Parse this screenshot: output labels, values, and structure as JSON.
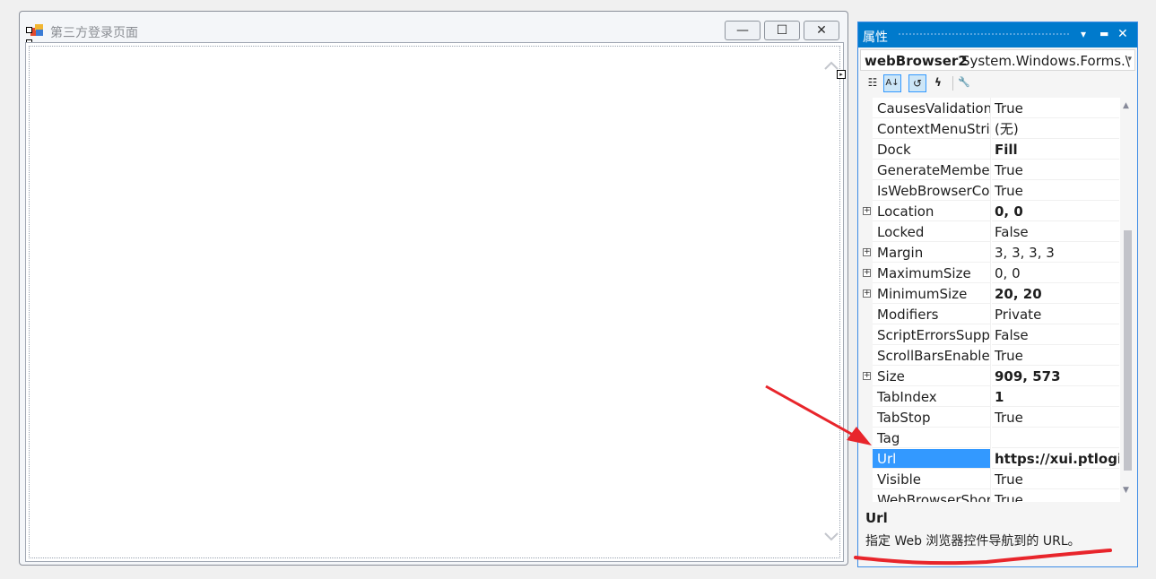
{
  "form": {
    "title": "第三方登录页面",
    "minimize_glyph": "—",
    "maximize_glyph": "☐",
    "close_glyph": "✕"
  },
  "properties_panel": {
    "title": "属性",
    "dropdown_glyph": "▾",
    "pin_glyph": "▬",
    "close_glyph": "✕",
    "object_name": "webBrowser2",
    "object_type": "System.Windows.Forms.\\",
    "toolbar": {
      "categorized_glyph": "☷",
      "alphabetical_glyph": "A↓",
      "properties_glyph": "↺",
      "events_glyph": "ϟ",
      "property_pages_glyph": "🔧"
    },
    "rows": [
      {
        "name": "CausesValidation",
        "value": "True",
        "bold": false,
        "expandable": false
      },
      {
        "name": "ContextMenuStrip",
        "value": "(无)",
        "bold": false,
        "expandable": false
      },
      {
        "name": "Dock",
        "value": "Fill",
        "bold": true,
        "expandable": false
      },
      {
        "name": "GenerateMember",
        "value": "True",
        "bold": false,
        "expandable": false
      },
      {
        "name": "IsWebBrowserContextMenuEnabled",
        "value": "True",
        "bold": false,
        "expandable": false
      },
      {
        "name": "Location",
        "value": "0, 0",
        "bold": true,
        "expandable": true
      },
      {
        "name": "Locked",
        "value": "False",
        "bold": false,
        "expandable": false
      },
      {
        "name": "Margin",
        "value": "3, 3, 3, 3",
        "bold": false,
        "expandable": true
      },
      {
        "name": "MaximumSize",
        "value": "0, 0",
        "bold": false,
        "expandable": true
      },
      {
        "name": "MinimumSize",
        "value": "20, 20",
        "bold": true,
        "expandable": true
      },
      {
        "name": "Modifiers",
        "value": "Private",
        "bold": false,
        "expandable": false
      },
      {
        "name": "ScriptErrorsSuppressed",
        "value": "False",
        "bold": false,
        "expandable": false
      },
      {
        "name": "ScrollBarsEnabled",
        "value": "True",
        "bold": false,
        "expandable": false
      },
      {
        "name": "Size",
        "value": "909, 573",
        "bold": true,
        "expandable": true
      },
      {
        "name": "TabIndex",
        "value": "1",
        "bold": true,
        "expandable": false
      },
      {
        "name": "TabStop",
        "value": "True",
        "bold": false,
        "expandable": false
      },
      {
        "name": "Tag",
        "value": "",
        "bold": false,
        "expandable": false
      },
      {
        "name": "Url",
        "value": "https://xui.ptlogin",
        "bold": true,
        "expandable": false,
        "selected": true
      },
      {
        "name": "Visible",
        "value": "True",
        "bold": false,
        "expandable": false
      },
      {
        "name": "WebBrowserShortcutsEnabled",
        "value": "True",
        "bold": false,
        "expandable": false
      }
    ],
    "description": {
      "title": "Url",
      "text": "指定 Web 浏览器控件导航到的 URL。"
    }
  },
  "colors": {
    "accent": "#007acc",
    "selection": "#3399ff",
    "annotation_red": "#e8252b"
  }
}
